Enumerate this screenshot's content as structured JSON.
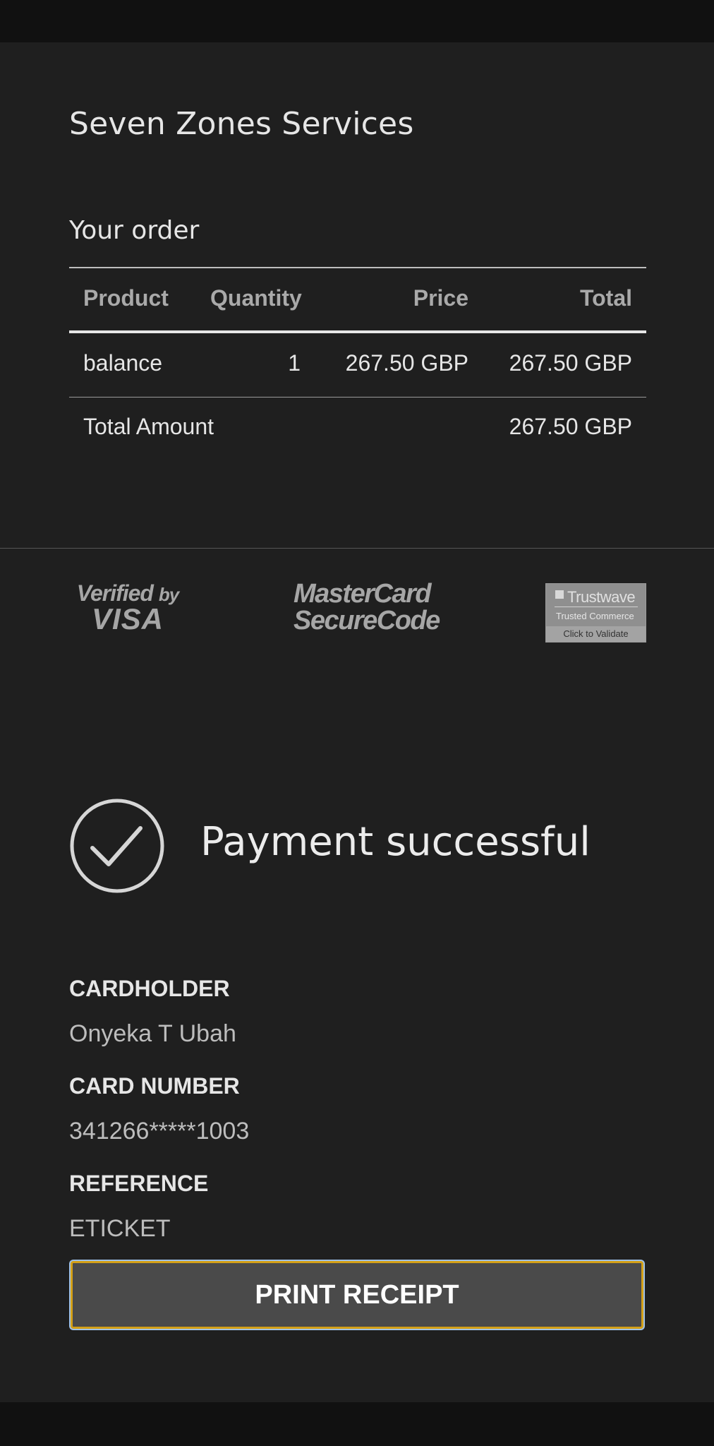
{
  "merchant": {
    "name": "Seven Zones Services"
  },
  "order": {
    "heading": "Your order",
    "columns": [
      "Product",
      "Quantity",
      "Price",
      "Total"
    ],
    "rows": [
      {
        "product": "balance",
        "quantity": "1",
        "price": "267.50 GBP",
        "total": "267.50 GBP"
      }
    ],
    "total_label": "Total Amount",
    "total_value": "267.50 GBP"
  },
  "badges": {
    "visa_line1": "Verified",
    "visa_by": "by",
    "visa_line2": "VISA",
    "mc_line1": "MasterCard",
    "mc_line2": "SecureCode",
    "trustwave_name": "Trustwave",
    "trustwave_sub": "Trusted Commerce",
    "trustwave_foot": "Click to Validate"
  },
  "status": {
    "message": "Payment successful"
  },
  "details": [
    {
      "label": "CARDHOLDER",
      "value": "Onyeka T Ubah"
    },
    {
      "label": "CARD NUMBER",
      "value": "341266*****1003"
    },
    {
      "label": "REFERENCE",
      "value": "ETICKET"
    }
  ],
  "actions": {
    "print_label": "PRINT RECEIPT"
  },
  "colors": {
    "background": "#1f1f1f",
    "button_fill": "#4a4a4a",
    "button_border": "#d4a017"
  }
}
